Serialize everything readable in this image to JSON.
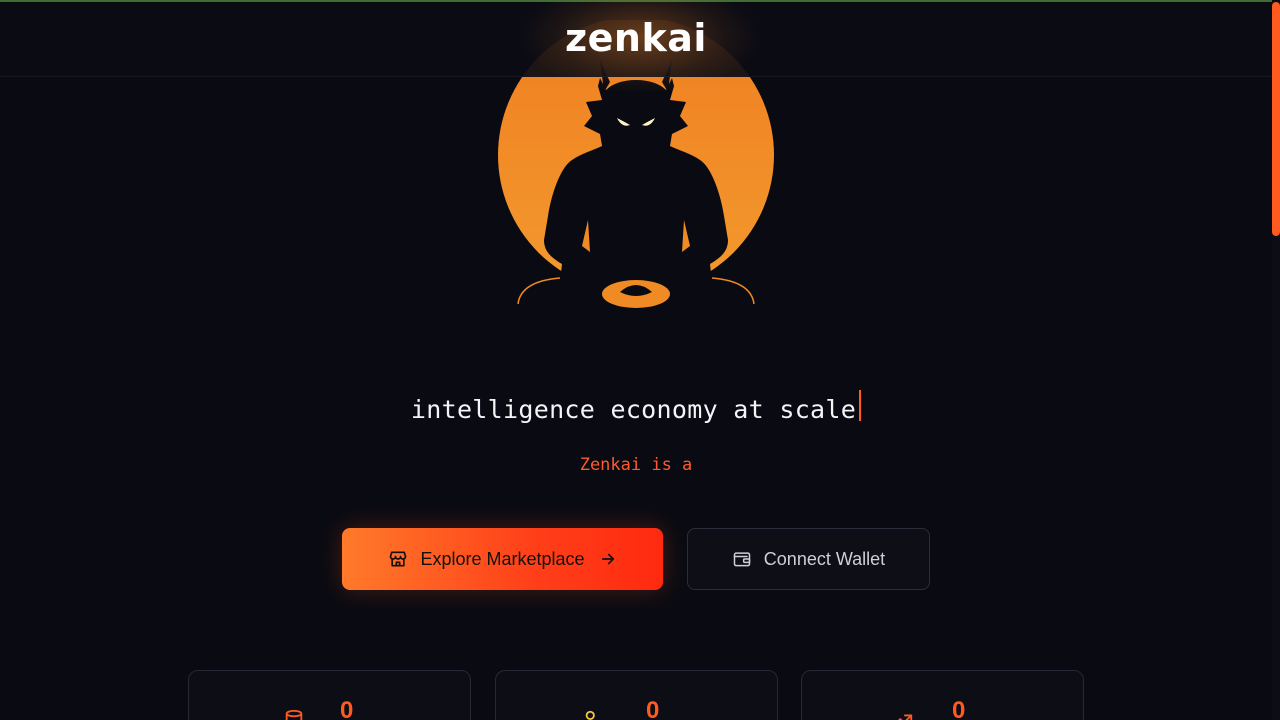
{
  "header": {
    "logo_text": "zenkai"
  },
  "hero": {
    "tagline": "intelligence economy at scale",
    "subline": "Zenkai is a"
  },
  "actions": {
    "primary_label": "Explore Marketplace",
    "secondary_label": "Connect Wallet"
  },
  "stats": [
    {
      "value": "0",
      "icon": "database-icon"
    },
    {
      "value": "0",
      "icon": "users-icon"
    },
    {
      "value": "0",
      "icon": "trending-up-icon"
    }
  ],
  "colors": {
    "accent": "#ff5a1f",
    "accent_gradient_start": "#ff7a2a",
    "accent_gradient_end": "#ff2a10",
    "sun": "#f08a24",
    "background": "#0a0b12"
  }
}
